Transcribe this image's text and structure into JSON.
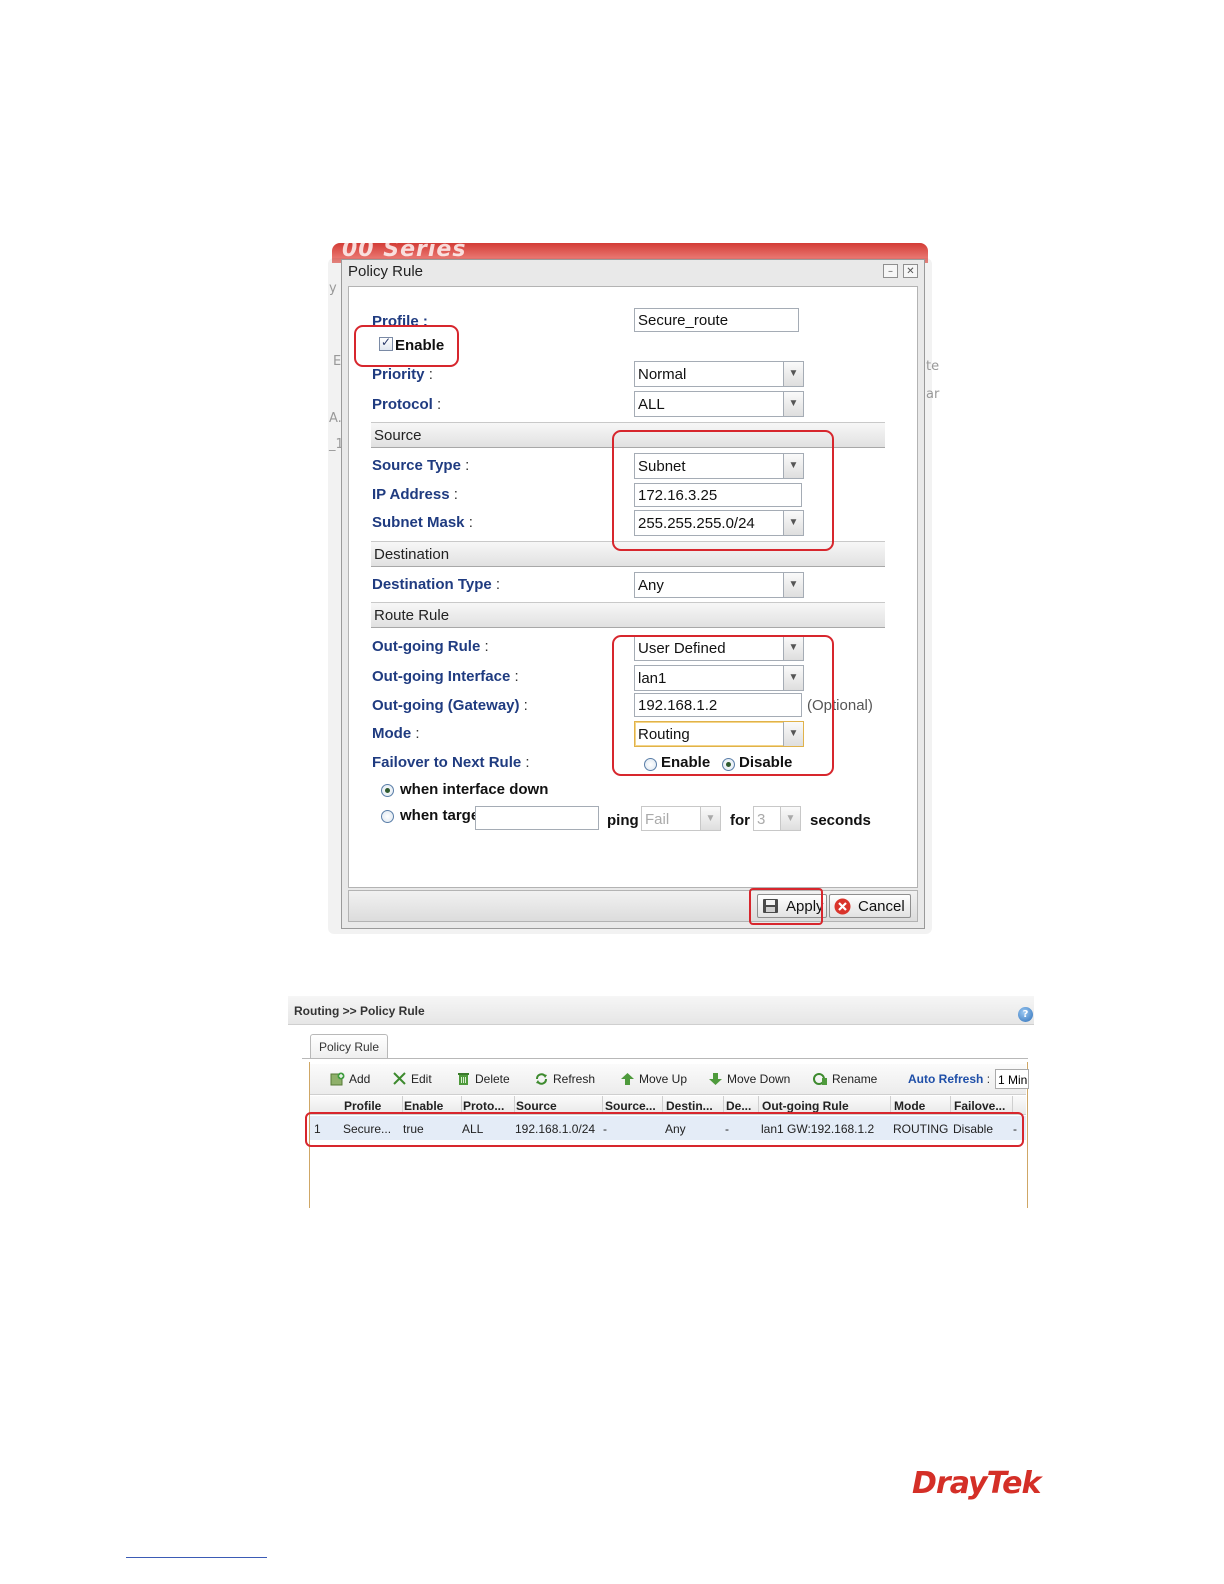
{
  "dialog": {
    "header_strip_text": "00 Series",
    "title": "Policy Rule",
    "minimize_glyph": "–",
    "close_glyph": "✕",
    "profile_label": "Profile :",
    "profile_value": "Secure_route",
    "enable_label": "Enable",
    "enable_checked": true,
    "priority_label": "Priority",
    "priority_value": "Normal",
    "protocol_label": "Protocol",
    "protocol_value": "ALL",
    "source_section": "Source",
    "source_type_label": "Source Type",
    "source_type_value": "Subnet",
    "ip_address_label": "IP Address",
    "ip_address_value": "172.16.3.25",
    "subnet_mask_label": "Subnet Mask",
    "subnet_mask_value": "255.255.255.0/24",
    "destination_section": "Destination",
    "destination_type_label": "Destination Type",
    "destination_type_value": "Any",
    "route_rule_section": "Route Rule",
    "outgoing_rule_label": "Out-going Rule",
    "outgoing_rule_value": "User Defined",
    "outgoing_interface_label": "Out-going Interface",
    "outgoing_interface_value": "lan1",
    "outgoing_gateway_label": "Out-going (Gateway)",
    "outgoing_gateway_value": "192.168.1.2",
    "optional_hint": "(Optional)",
    "mode_label": "Mode",
    "mode_value": "Routing",
    "failover_label": "Failover to Next Rule",
    "failover_enable": "Enable",
    "failover_disable": "Disable",
    "failover_selected": "Disable",
    "when_interface_down": "when interface down",
    "when_target": "when targe",
    "target_value": "",
    "ping_label": "ping",
    "ping_value": "Fail",
    "for_label": "for",
    "for_value": "3",
    "seconds_label": "seconds",
    "apply_label": "Apply",
    "cancel_label": "Cancel",
    "colon": ":"
  },
  "background_fragments": {
    "left": [
      "y",
      "E",
      "A.",
      "_1"
    ],
    "right": [
      "te",
      "ar"
    ]
  },
  "grid_panel": {
    "breadcrumb": "Routing >> Policy Rule",
    "help_glyph": "?",
    "tab": "Policy Rule",
    "toolbar": {
      "add": "Add",
      "edit": "Edit",
      "delete": "Delete",
      "refresh": "Refresh",
      "move_up": "Move Up",
      "move_down": "Move Down",
      "rename": "Rename",
      "auto_refresh_label": "Auto Refresh",
      "auto_refresh_value": "1 Min"
    },
    "columns": [
      "Profile",
      "Enable",
      "Proto...",
      "Source",
      "Source...",
      "Destin...",
      "De...",
      "Out-going Rule",
      "Mode",
      "Failove..."
    ],
    "rows": [
      [
        "1",
        "Secure...",
        "true",
        "ALL",
        "192.168.1.0/24",
        "-",
        "Any",
        "-",
        "lan1 GW:192.168.1.2",
        "ROUTING",
        "Disable",
        "-"
      ]
    ]
  },
  "logo": "DrayTek",
  "colors": {
    "highlight": "#d7262d",
    "label_blue": "#1f3b80",
    "logo_red": "#d42f27"
  }
}
